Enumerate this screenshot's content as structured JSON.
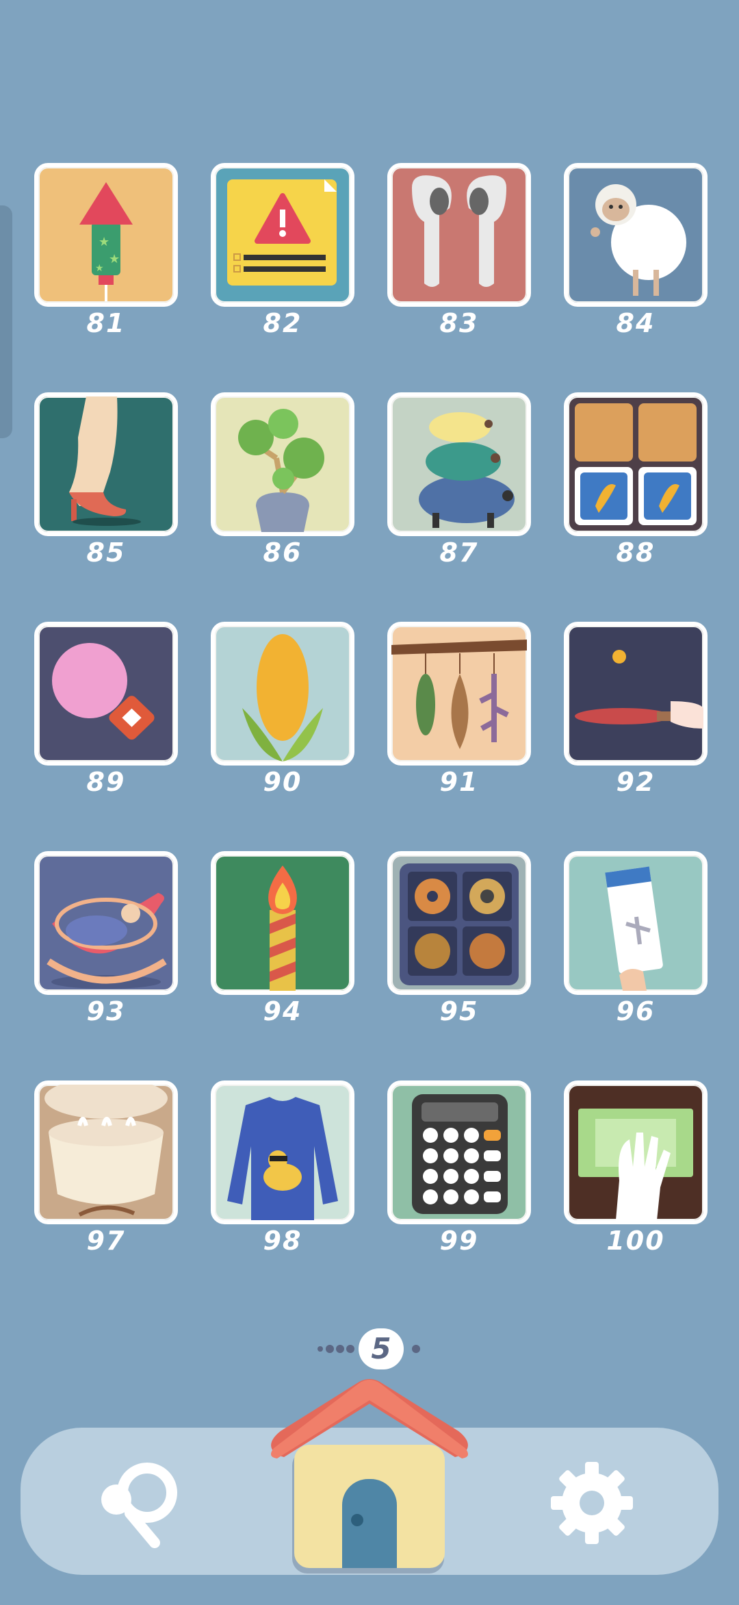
{
  "levels": [
    {
      "number": "81",
      "icon": "firework-rocket-icon",
      "bg": "#efc07a"
    },
    {
      "number": "82",
      "icon": "warning-sign-icon",
      "bg": "#5aa3b8"
    },
    {
      "number": "83",
      "icon": "earbuds-icon",
      "bg": "#c97871"
    },
    {
      "number": "84",
      "icon": "sheep-icon",
      "bg": "#6a8cab"
    },
    {
      "number": "85",
      "icon": "high-heel-leg-icon",
      "bg": "#2f6f6d"
    },
    {
      "number": "86",
      "icon": "succulent-plant-icon",
      "bg": "#e5e5b8"
    },
    {
      "number": "87",
      "icon": "stacked-turtles-icon",
      "bg": "#c4d3c5"
    },
    {
      "number": "88",
      "icon": "cookie-box-icon",
      "bg": "#4e3f48"
    },
    {
      "number": "89",
      "icon": "balloon-star-icon",
      "bg": "#4d4f6f"
    },
    {
      "number": "90",
      "icon": "corn-icon",
      "bg": "#b4d3d5"
    },
    {
      "number": "91",
      "icon": "hanging-shells-icon",
      "bg": "#f3cda6"
    },
    {
      "number": "92",
      "icon": "ping-pong-paddle-icon",
      "bg": "#3d405c"
    },
    {
      "number": "93",
      "icon": "baby-cradle-icon",
      "bg": "#5f6c9a"
    },
    {
      "number": "94",
      "icon": "candle-icon",
      "bg": "#3e8a5e"
    },
    {
      "number": "95",
      "icon": "cookie-tin-icon",
      "bg": "#9fb2b4"
    },
    {
      "number": "96",
      "icon": "boarding-pass-icon",
      "bg": "#98c8c2"
    },
    {
      "number": "97",
      "icon": "steamer-basket-icon",
      "bg": "#c9a98a"
    },
    {
      "number": "98",
      "icon": "duck-sweater-icon",
      "bg": "#cde3da"
    },
    {
      "number": "99",
      "icon": "calculator-icon",
      "bg": "#8fbfa6"
    },
    {
      "number": "100",
      "icon": "money-counting-icon",
      "bg": "#4e2f25"
    }
  ],
  "pager": {
    "current_page": "5"
  },
  "nav": {
    "left_icon": "hint-magnifier-icon",
    "center_icon": "home-house-icon",
    "right_icon": "settings-gear-icon"
  },
  "colors": {
    "background": "#7fa3bf",
    "navbar": "#b9cfdf",
    "roof": "#f07f6a",
    "house": "#f3e2a2",
    "door": "#4f86a6"
  }
}
